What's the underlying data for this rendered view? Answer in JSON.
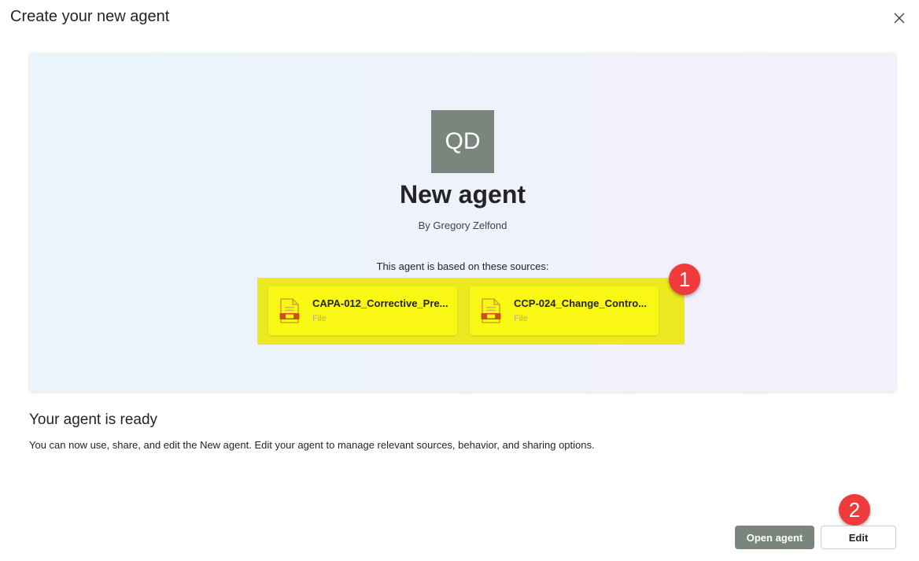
{
  "dialog": {
    "title": "Create your new agent",
    "close_icon": "close-icon"
  },
  "agent": {
    "initials": "QD",
    "name": "New agent",
    "author": "By Gregory Zelfond",
    "avatar_color": "#7a857e"
  },
  "sources": {
    "label": "This agent is based on these sources:",
    "items": [
      {
        "name": "CAPA-012_Corrective_Pre...",
        "type": "File",
        "icon": "file-icon"
      },
      {
        "name": "CCP-024_Change_Contro...",
        "type": "File",
        "icon": "file-icon"
      }
    ],
    "highlight_color": "#ede920"
  },
  "markers": [
    "1",
    "2"
  ],
  "marker_color": "#ef3b3b",
  "ready": {
    "title": "Your agent is ready",
    "description": "You can now use, share, and edit the New agent. Edit your agent to manage relevant sources, behavior, and sharing options."
  },
  "actions": {
    "open_label": "Open agent",
    "edit_label": "Edit"
  }
}
